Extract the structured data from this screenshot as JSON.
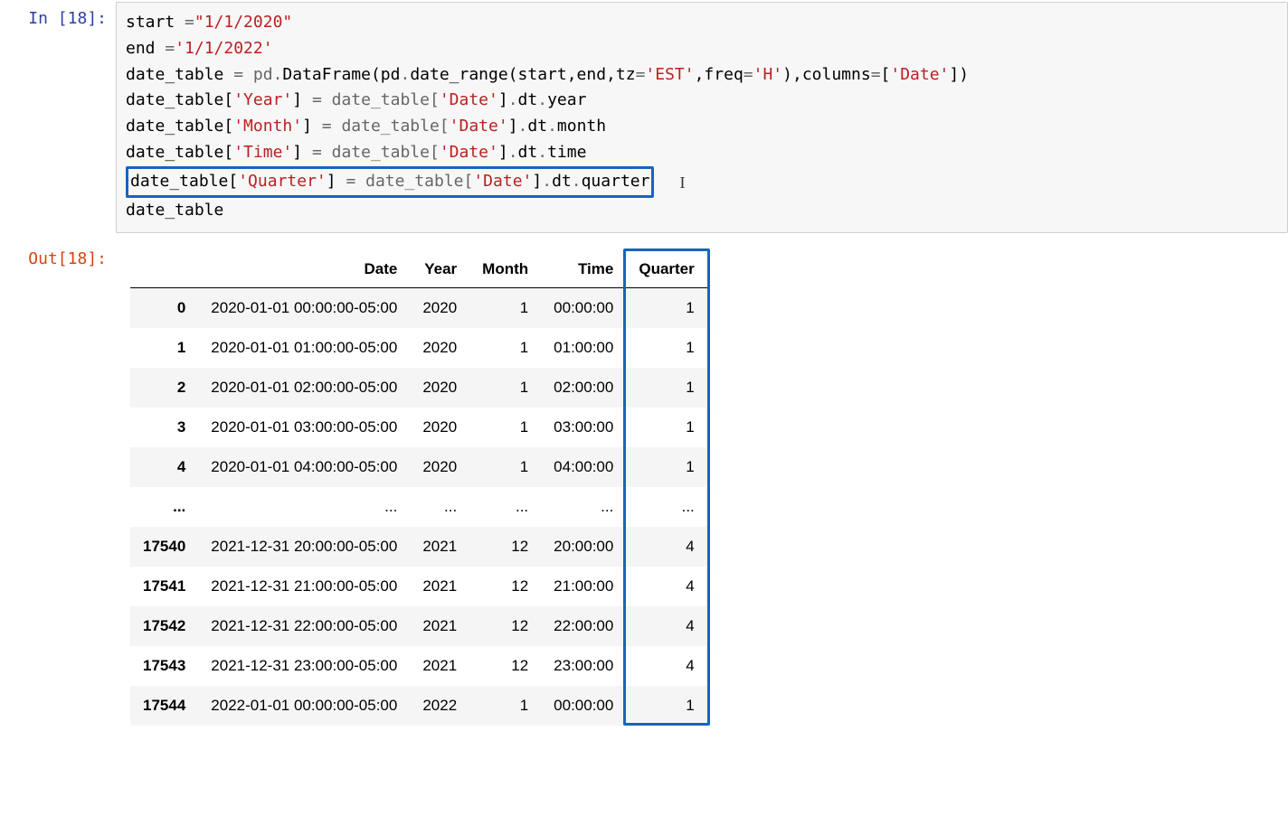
{
  "cell": {
    "exec_count": "18",
    "in_label": "In [18]:",
    "out_label": "Out[18]:",
    "code": {
      "l1a": "start ",
      "l1b": "=",
      "l1c": "\"1/1/2020\"",
      "l2a": "end ",
      "l2b": "=",
      "l2c": "'1/1/2022'",
      "l3a": "date_table ",
      "l3b": "= pd",
      "l3c": ".",
      "l3d": "DataFrame(pd",
      "l3e": ".",
      "l3f": "date_range(start,end,tz",
      "l3g": "=",
      "l3h": "'EST'",
      "l3i": ",freq",
      "l3j": "=",
      "l3k": "'H'",
      "l3l": "),columns",
      "l3m": "=",
      "l3n": "[",
      "l3o": "'Date'",
      "l3p": "])",
      "l4a": "date_table[",
      "l4b": "'Year'",
      "l4c": "] ",
      "l4d": "= date_table[",
      "l4e": "'Date'",
      "l4f": "]",
      "l4g": ".",
      "l4h": "dt",
      "l4i": ".",
      "l4j": "year",
      "l5a": "date_table[",
      "l5b": "'Month'",
      "l5c": "] ",
      "l5d": "= date_table[",
      "l5e": "'Date'",
      "l5f": "]",
      "l5g": ".",
      "l5h": "dt",
      "l5i": ".",
      "l5j": "month",
      "l6a": "date_table[",
      "l6b": "'Time'",
      "l6c": "] ",
      "l6d": "= date_table[",
      "l6e": "'Date'",
      "l6f": "]",
      "l6g": ".",
      "l6h": "dt",
      "l6i": ".",
      "l6j": "time",
      "l7a": "date_table[",
      "l7b": "'Quarter'",
      "l7c": "] ",
      "l7d": "= date_table[",
      "l7e": "'Date'",
      "l7f": "]",
      "l7g": ".",
      "l7h": "dt",
      "l7i": ".",
      "l7j": "quarter",
      "l8": "date_table",
      "caret": "I"
    }
  },
  "table": {
    "columns": [
      "",
      "Date",
      "Year",
      "Month",
      "Time",
      "Quarter"
    ],
    "rows": [
      {
        "idx": "0",
        "date": "2020-01-01 00:00:00-05:00",
        "year": "2020",
        "month": "1",
        "time": "00:00:00",
        "quarter": "1"
      },
      {
        "idx": "1",
        "date": "2020-01-01 01:00:00-05:00",
        "year": "2020",
        "month": "1",
        "time": "01:00:00",
        "quarter": "1"
      },
      {
        "idx": "2",
        "date": "2020-01-01 02:00:00-05:00",
        "year": "2020",
        "month": "1",
        "time": "02:00:00",
        "quarter": "1"
      },
      {
        "idx": "3",
        "date": "2020-01-01 03:00:00-05:00",
        "year": "2020",
        "month": "1",
        "time": "03:00:00",
        "quarter": "1"
      },
      {
        "idx": "4",
        "date": "2020-01-01 04:00:00-05:00",
        "year": "2020",
        "month": "1",
        "time": "04:00:00",
        "quarter": "1"
      },
      {
        "idx": "...",
        "date": "...",
        "year": "...",
        "month": "...",
        "time": "...",
        "quarter": "..."
      },
      {
        "idx": "17540",
        "date": "2021-12-31 20:00:00-05:00",
        "year": "2021",
        "month": "12",
        "time": "20:00:00",
        "quarter": "4"
      },
      {
        "idx": "17541",
        "date": "2021-12-31 21:00:00-05:00",
        "year": "2021",
        "month": "12",
        "time": "21:00:00",
        "quarter": "4"
      },
      {
        "idx": "17542",
        "date": "2021-12-31 22:00:00-05:00",
        "year": "2021",
        "month": "12",
        "time": "22:00:00",
        "quarter": "4"
      },
      {
        "idx": "17543",
        "date": "2021-12-31 23:00:00-05:00",
        "year": "2021",
        "month": "12",
        "time": "23:00:00",
        "quarter": "4"
      },
      {
        "idx": "17544",
        "date": "2022-01-01 00:00:00-05:00",
        "year": "2022",
        "month": "1",
        "time": "00:00:00",
        "quarter": "1"
      }
    ]
  }
}
